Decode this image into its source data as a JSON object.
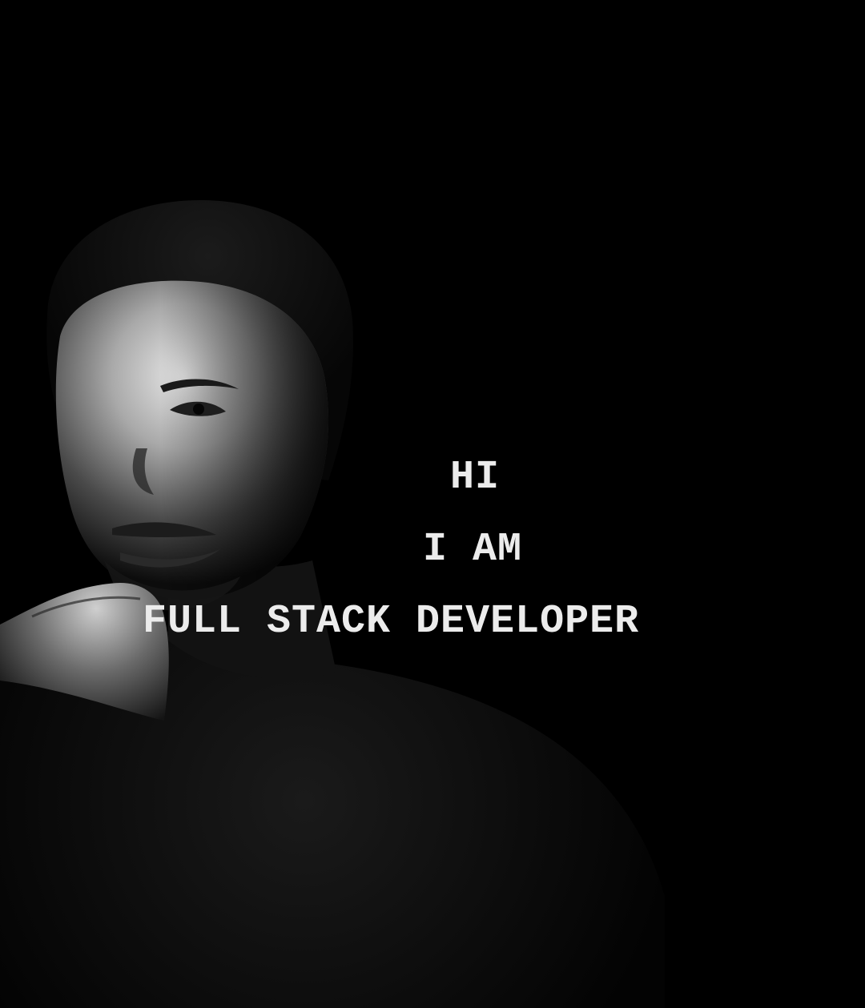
{
  "headline": {
    "line1": "HI",
    "line2": "I AM",
    "line3": "FULL STACK DEVELOPER"
  },
  "colors": {
    "background": "#000000",
    "text": "#ececec"
  }
}
